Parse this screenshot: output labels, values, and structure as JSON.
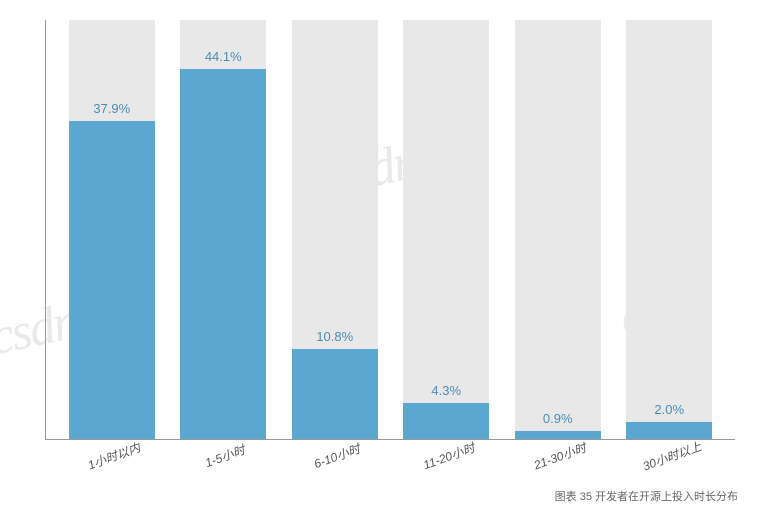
{
  "chart_data": {
    "type": "bar",
    "categories": [
      "1小时以内",
      "1-5小时",
      "6-10小时",
      "11-20小时",
      "21-30小时",
      "30小时以上"
    ],
    "values": [
      37.9,
      44.1,
      10.8,
      4.3,
      0.9,
      2.0
    ],
    "value_labels": [
      "37.9%",
      "44.1%",
      "10.8%",
      "4.3%",
      "0.9%",
      "2.0%"
    ],
    "title": "",
    "xlabel": "",
    "ylabel": "",
    "ylim": [
      0,
      50
    ]
  },
  "caption": "图表 35 开发者在开源上投入时长分布",
  "watermark": "csdn",
  "colors": {
    "bar": "#5ba7d0",
    "bar_bg": "#e8e8e8",
    "label": "#4a8db5"
  }
}
